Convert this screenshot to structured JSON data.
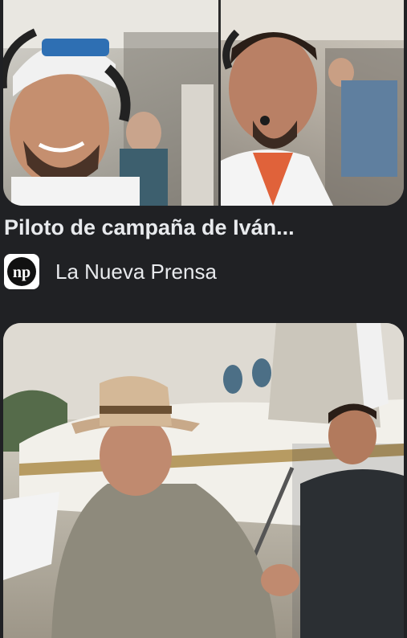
{
  "result": {
    "title": "Piloto de campaña de Iván...",
    "source": {
      "name": "La Nueva Prensa",
      "logo_text": "np"
    }
  },
  "colors": {
    "background": "#202124",
    "text": "#e8eaed",
    "logo_bg": "#ffffff",
    "logo_fg": "#111111"
  },
  "icons": [
    "source-logo-icon"
  ]
}
